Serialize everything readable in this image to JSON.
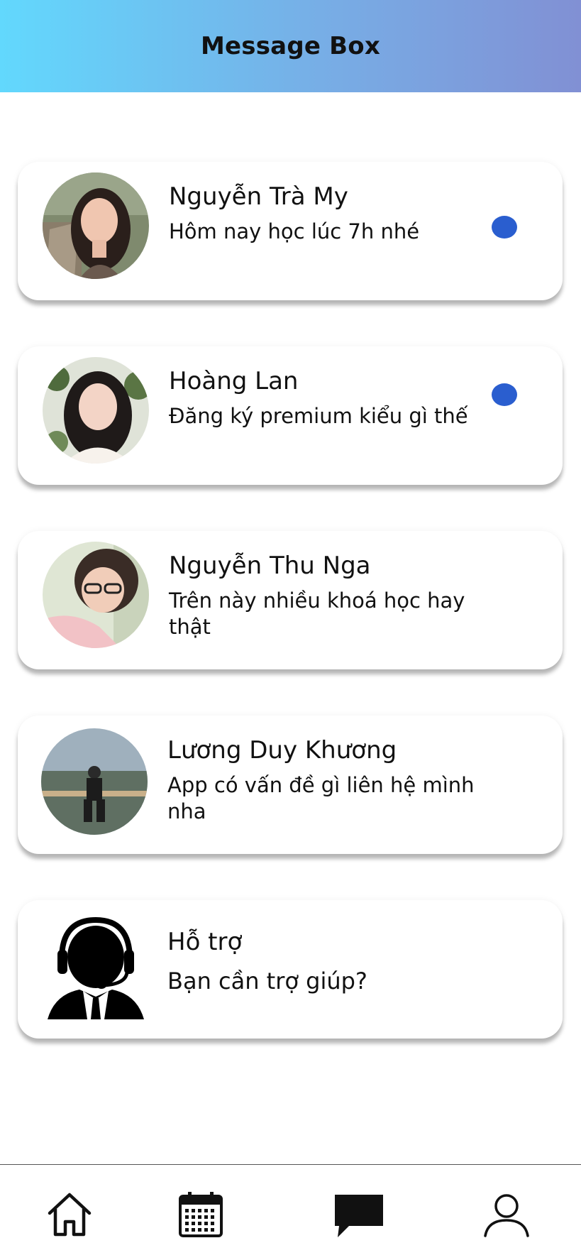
{
  "header": {
    "title": "Message Box",
    "gradient_start": "#62d8fd",
    "gradient_end": "#8190d4"
  },
  "conversations": [
    {
      "name": "Nguyễn Trà My",
      "preview": "Hôm nay học lúc 7h nhé",
      "unread": true,
      "avatar": "photo-avatar"
    },
    {
      "name": "Hoàng Lan",
      "preview": "Đăng ký premium kiểu gì thế",
      "unread": true,
      "avatar": "photo-avatar"
    },
    {
      "name": "Nguyễn Thu Nga",
      "preview": "Trên này nhiều khoá học hay thật",
      "unread": false,
      "avatar": "photo-avatar"
    },
    {
      "name": "Lương Duy Khương",
      "preview": "App có vấn đề gì liên hệ mình nha",
      "unread": false,
      "avatar": "photo-avatar"
    },
    {
      "name": "Hỗ trợ",
      "preview": "Bạn cần trợ giúp?",
      "unread": false,
      "avatar": "support-agent-icon"
    }
  ],
  "unread_color": "#2a5ecf",
  "bottom_nav": [
    {
      "icon": "home-icon"
    },
    {
      "icon": "calendar-icon"
    },
    {
      "icon": "chat-icon",
      "active": true
    },
    {
      "icon": "profile-icon"
    }
  ]
}
